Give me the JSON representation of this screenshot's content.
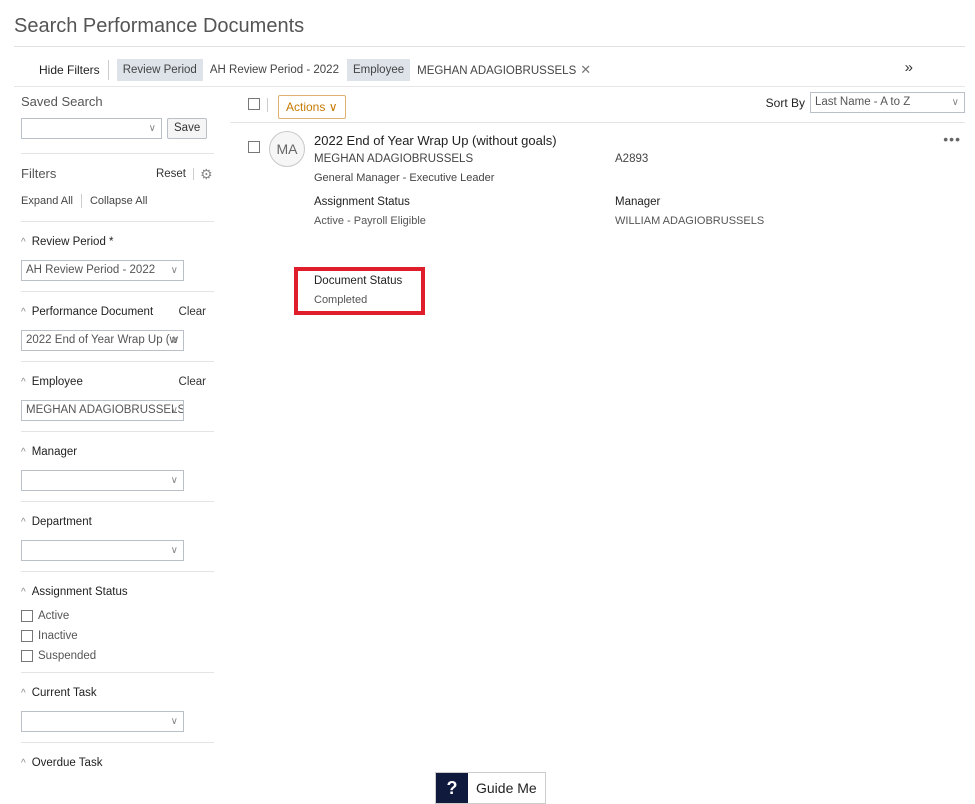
{
  "page": {
    "title": "Search Performance Documents"
  },
  "filterbar": {
    "hide_filters": "Hide Filters",
    "chips": [
      {
        "key": "Review Period",
        "value": "AH Review Period - 2022",
        "removable": false
      },
      {
        "key": "Employee",
        "value": "MEGHAN ADAGIOBRUSSELS",
        "removable": true
      }
    ],
    "expand_icon": "double-chevron-right-icon",
    "expand_glyph": "»"
  },
  "sidebar": {
    "saved_search_label": "Saved Search",
    "saved_search_value": "",
    "save_label": "Save",
    "filters_label": "Filters",
    "reset_label": "Reset",
    "expand_all": "Expand All",
    "collapse_all": "Collapse All",
    "sections": {
      "review_period": {
        "label": "Review Period *",
        "value": "AH Review Period - 2022"
      },
      "performance_document": {
        "label": "Performance Document",
        "clear": "Clear",
        "value": "2022 End of Year Wrap Up (w"
      },
      "employee": {
        "label": "Employee",
        "clear": "Clear",
        "value": "MEGHAN ADAGIOBRUSSELS"
      },
      "manager": {
        "label": "Manager",
        "value": ""
      },
      "department": {
        "label": "Department",
        "value": ""
      },
      "assignment_status": {
        "label": "Assignment Status",
        "options": [
          "Active",
          "Inactive",
          "Suspended"
        ]
      },
      "current_task": {
        "label": "Current Task",
        "value": ""
      },
      "overdue_task": {
        "label": "Overdue Task"
      }
    }
  },
  "main": {
    "actions_label": "Actions",
    "sort_by_label": "Sort By",
    "sort_value": "Last Name - A to Z",
    "document": {
      "avatar_initials": "MA",
      "title": "2022 End of Year Wrap Up (without goals)",
      "employee": "MEGHAN ADAGIOBRUSSELS",
      "employee_id": "A2893",
      "role": "General Manager - Executive Leader",
      "assignment_status_label": "Assignment Status",
      "assignment_status_value": "Active - Payroll Eligible",
      "manager_label": "Manager",
      "manager_value": "WILLIAM ADAGIOBRUSSELS",
      "document_status_label": "Document Status",
      "document_status_value": "Completed",
      "more_glyph": "•••"
    }
  },
  "guide": {
    "icon": "?",
    "label": "Guide Me"
  },
  "colors": {
    "highlight": "#e01e2b",
    "actions": "#c67a00",
    "chip_bg": "#dde3e9",
    "guide_bg": "#101a3c"
  }
}
